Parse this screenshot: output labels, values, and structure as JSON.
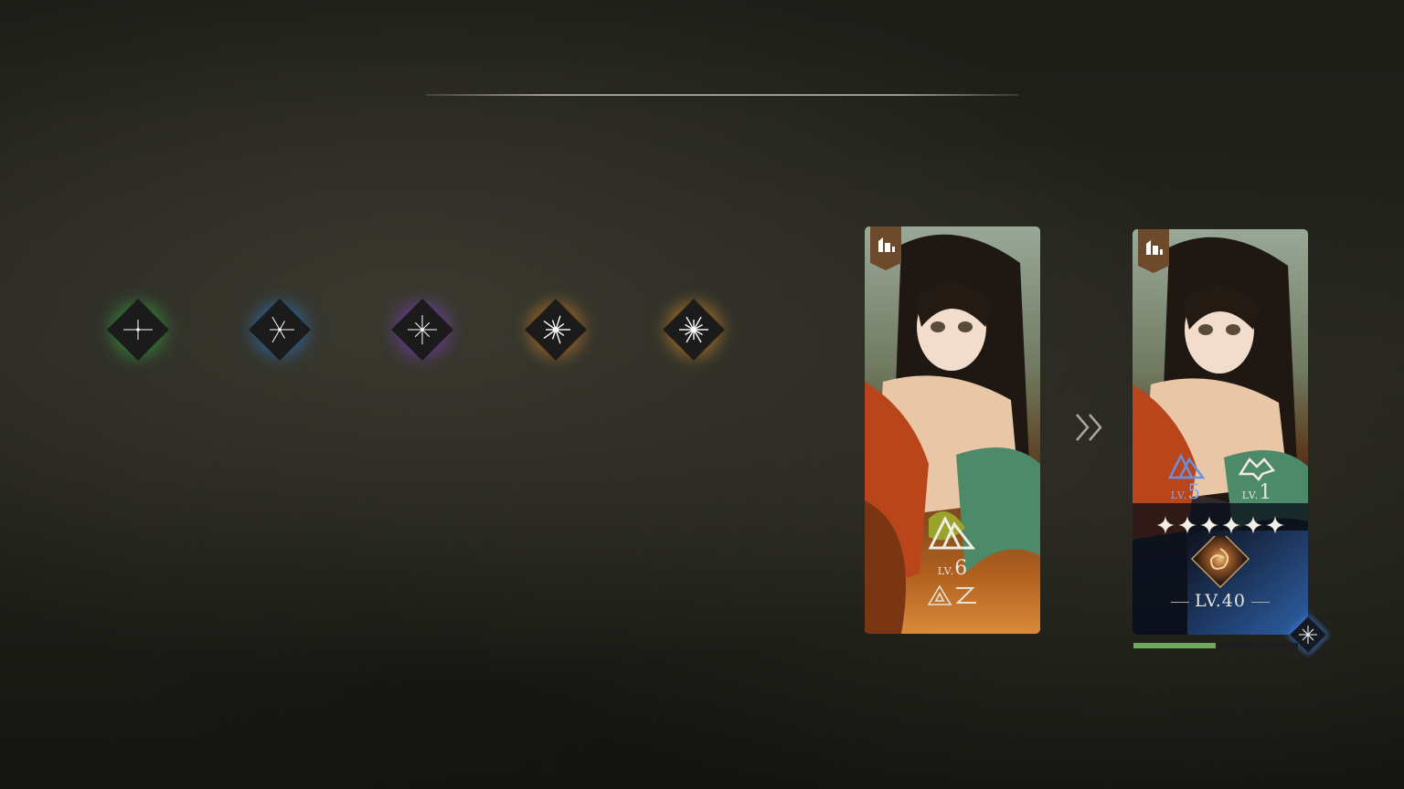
{
  "rarities": [
    {
      "name": "green",
      "color": "#3bb54a"
    },
    {
      "name": "blue",
      "color": "#2f80d6"
    },
    {
      "name": "purple",
      "color": "#8a3fd6"
    },
    {
      "name": "gold-1",
      "color": "#e08a2a"
    },
    {
      "name": "gold-2",
      "color": "#e99a2e"
    }
  ],
  "card_before": {
    "lv_prefix": "LV.",
    "lv_value": "6",
    "icon": "triangle-skill-icon",
    "sub_icon": "as-glyph-icon"
  },
  "card_after": {
    "skill1_prefix": "LV.",
    "skill1_value": "5",
    "skill2_prefix": "LV.",
    "skill2_value": "1",
    "stars": 6,
    "level_label": "LV.40",
    "rarity_color": "#3a7bd5",
    "progress": 0.5
  },
  "arrow_icon": "double-chevron-right-icon",
  "badge_icon": "building-icon"
}
